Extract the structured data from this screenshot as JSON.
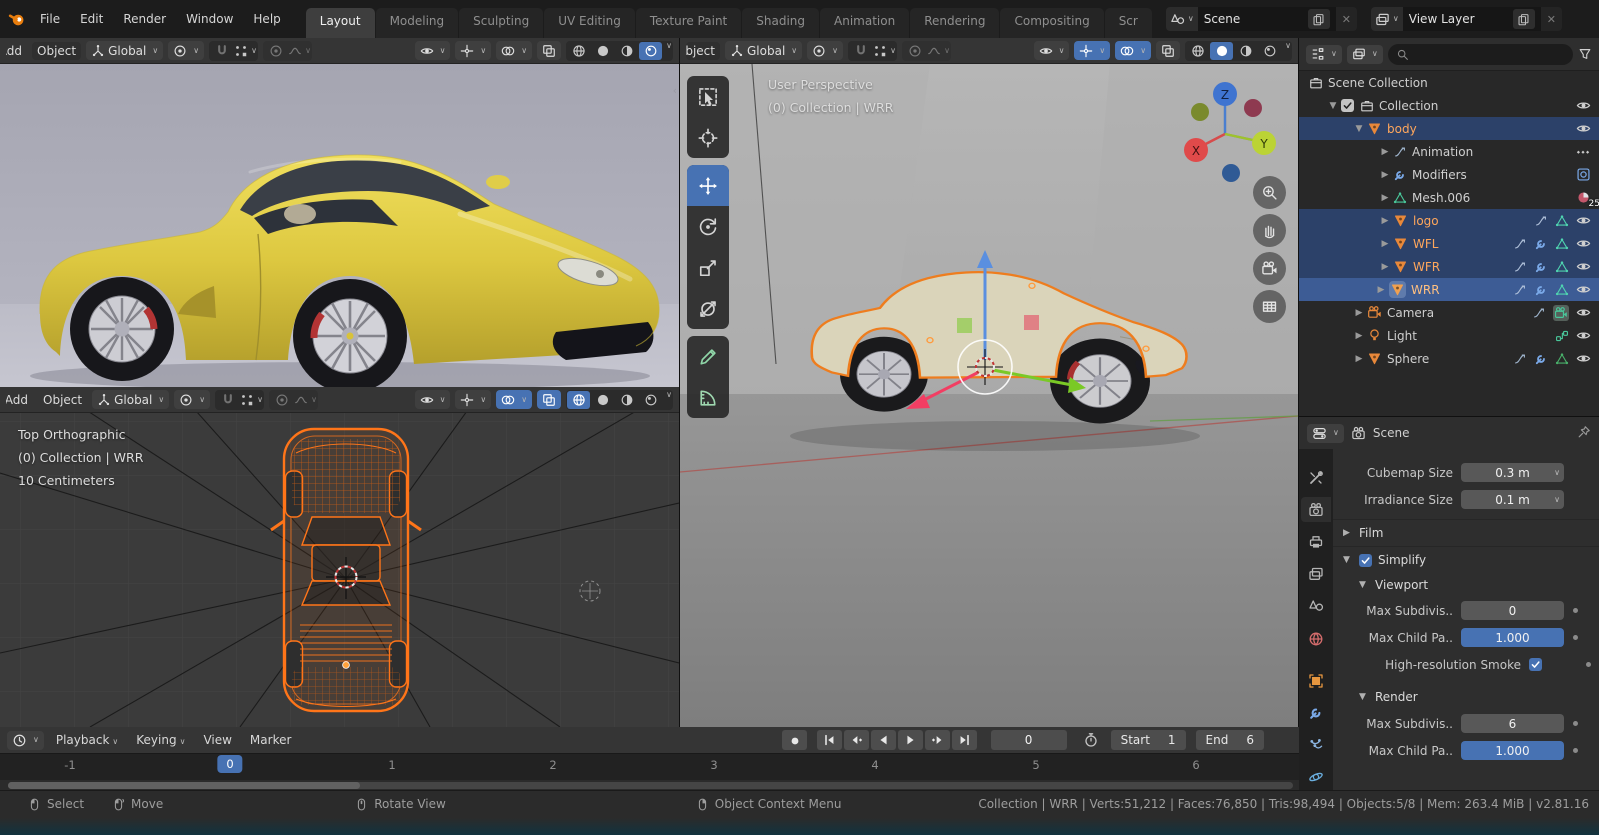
{
  "colors": {
    "accent_blue": "#4772b3",
    "selection_orange": "#ff7519",
    "outliner_selected_text": "#ffa75c",
    "header_bg": "#353535"
  },
  "topbar": {
    "menus": [
      "File",
      "Edit",
      "Render",
      "Window",
      "Help"
    ],
    "tabs": [
      {
        "label": "Layout",
        "active": true
      },
      {
        "label": "Modeling"
      },
      {
        "label": "Sculpting"
      },
      {
        "label": "UV Editing"
      },
      {
        "label": "Texture Paint"
      },
      {
        "label": "Shading"
      },
      {
        "label": "Animation"
      },
      {
        "label": "Rendering"
      },
      {
        "label": "Compositing"
      },
      {
        "label": "Scr"
      }
    ],
    "scene_selector": "Scene",
    "view_layer_selector": "View Layer"
  },
  "viewport_header": {
    "add": "Add",
    "object": "Object",
    "orientation": "Global"
  },
  "persp": {
    "overlay1": "User Perspective",
    "overlay2": "(0) Collection | WRR"
  },
  "ortho": {
    "overlay1": "Top Orthographic",
    "overlay2": "(0) Collection | WRR",
    "overlay3": "10 Centimeters"
  },
  "outliner": {
    "rows": [
      {
        "label": "Scene Collection"
      },
      {
        "label": "Collection",
        "checked": true
      },
      {
        "label": "body",
        "selected": true
      },
      {
        "label": "Animation"
      },
      {
        "label": "Modifiers"
      },
      {
        "label": "Mesh.006",
        "badge": "25"
      },
      {
        "label": "logo",
        "selected": true
      },
      {
        "label": "WFL",
        "selected": true
      },
      {
        "label": "WFR",
        "selected": true
      },
      {
        "label": "WRR",
        "selected": true,
        "active": true
      },
      {
        "label": "Camera"
      },
      {
        "label": "Light"
      },
      {
        "label": "Sphere"
      }
    ]
  },
  "properties": {
    "breadcrumb": "Scene",
    "shadow_rows": [
      {
        "label": "Cubemap Size",
        "value": "0.3 m"
      },
      {
        "label": "Irradiance Size",
        "value": "0.1 m"
      }
    ],
    "film_panel": "Film",
    "simplify_panel": "Simplify",
    "viewport_panel": "Viewport",
    "render_panel": "Render",
    "viewport_rows": [
      {
        "label": "Max Subdivis..",
        "value": "0"
      },
      {
        "label": "Max Child Pa..",
        "value": "1.000"
      }
    ],
    "smoke_label": "High-resolution Smoke",
    "render_rows": [
      {
        "label": "Max Subdivis..",
        "value": "6"
      },
      {
        "label": "Max Child Pa..",
        "value": "1.000"
      }
    ]
  },
  "timeline": {
    "menus": [
      "Playback",
      "Keying",
      "View",
      "Marker"
    ],
    "current_frame": "0",
    "start_label": "Start",
    "start_value": "1",
    "end_label": "End",
    "end_value": "6",
    "ticks": [
      "-1",
      "0",
      "1",
      "2",
      "3",
      "4",
      "5",
      "6"
    ]
  },
  "statusbar": {
    "hints": [
      "Select",
      "Move",
      "Rotate View",
      "Object Context Menu"
    ],
    "stats": "Collection | WRR | Verts:51,212 | Faces:76,850 | Tris:98,494 | Objects:5/8 | Mem: 263.4 MiB | v2.81.16"
  }
}
